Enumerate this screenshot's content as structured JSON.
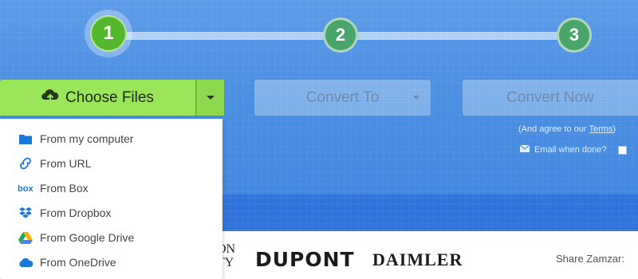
{
  "steps": [
    {
      "number": "1",
      "state": "active",
      "color": "#55b82c"
    },
    {
      "number": "2",
      "state": "pending",
      "color": "#4aa56a"
    },
    {
      "number": "3",
      "state": "pending",
      "color": "#4aa56a"
    }
  ],
  "actions": {
    "choose_files": "Choose Files",
    "convert_to": "Convert To",
    "convert_now": "Convert Now"
  },
  "agree": {
    "prefix": "(And agree to our ",
    "terms": "Terms",
    "suffix": ")"
  },
  "email": {
    "label": "Email when done?",
    "checked": false
  },
  "upload_menu": [
    {
      "label": "From my computer",
      "icon": "folder-icon"
    },
    {
      "label": "From URL",
      "icon": "link-icon"
    },
    {
      "label": "From Box",
      "icon": "box-icon"
    },
    {
      "label": "From Dropbox",
      "icon": "dropbox-icon"
    },
    {
      "label": "From Google Drive",
      "icon": "google-drive-icon"
    },
    {
      "label": "From OneDrive",
      "icon": "onedrive-icon"
    }
  ],
  "logos": {
    "partial_top": "ON",
    "partial_bottom": "TY",
    "dupont": "DUPONT",
    "daimler": "DAIMLER"
  },
  "share_label": "Share Zamzar:",
  "colors": {
    "hero": "#4a8fe4",
    "choose_files": "#9be55b",
    "step_active": "#55b82c"
  }
}
